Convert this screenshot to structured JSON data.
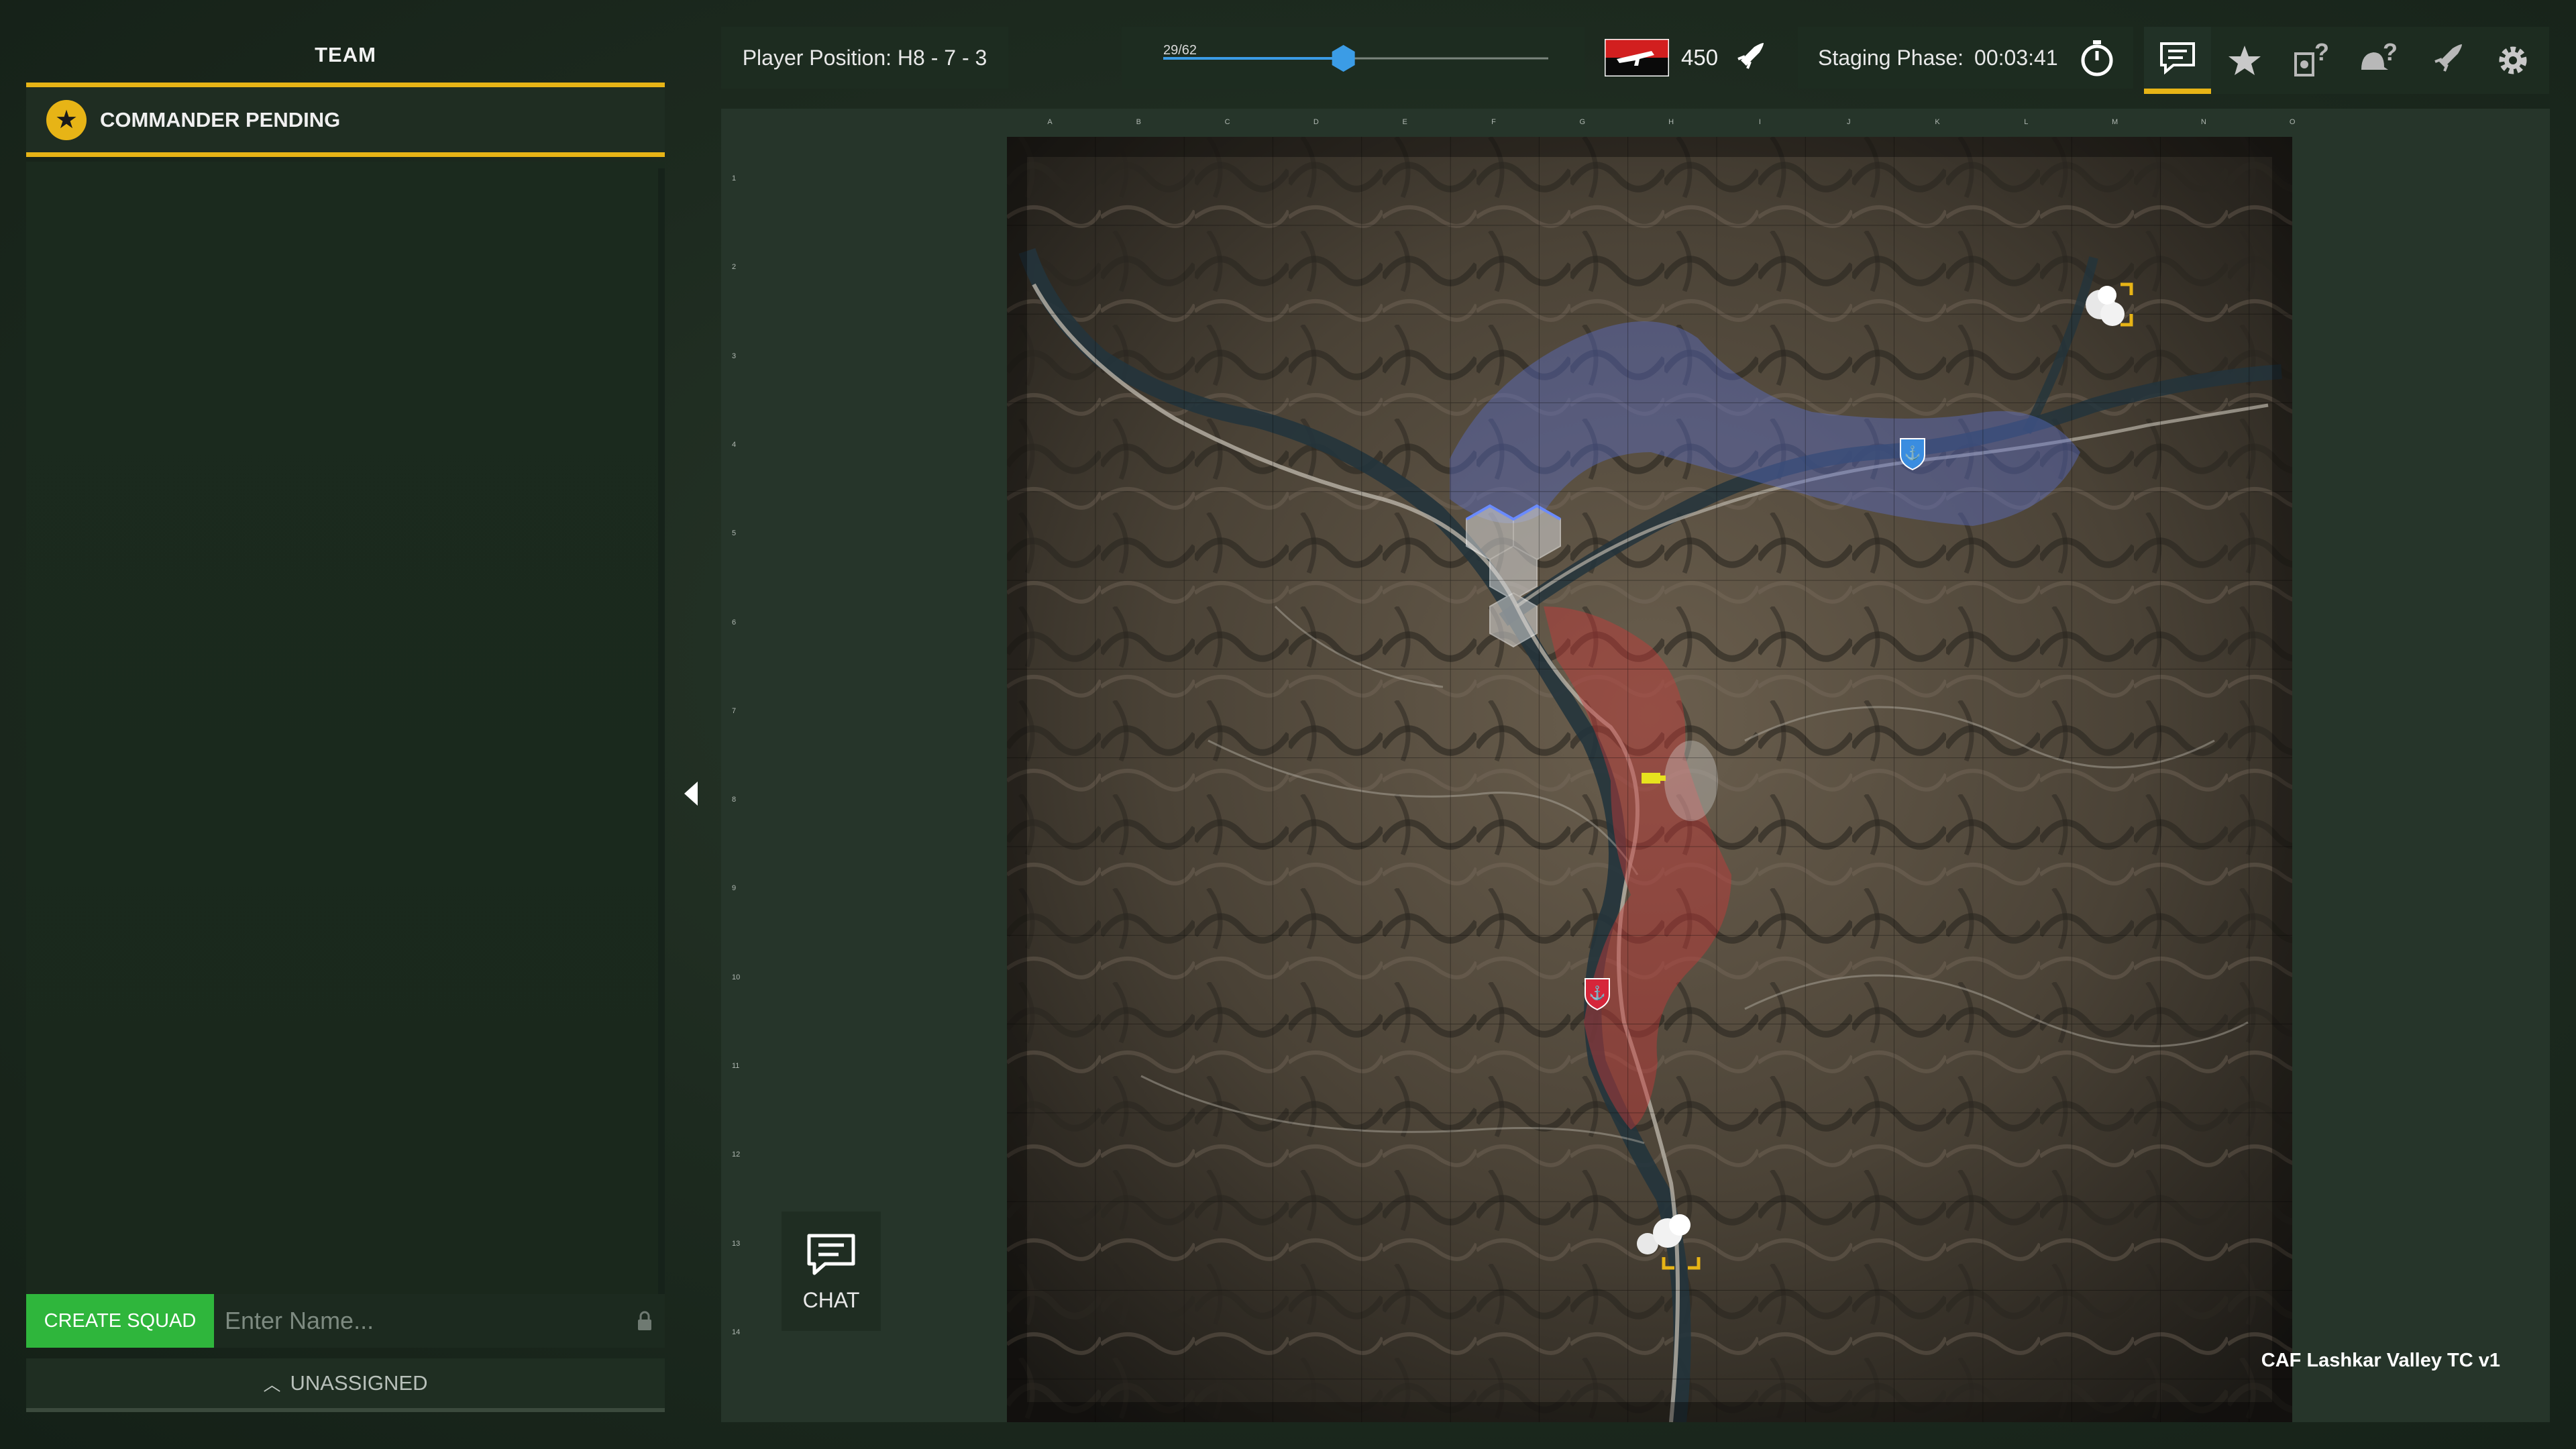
{
  "team_panel": {
    "title": "TEAM",
    "commander_label": "COMMANDER PENDING",
    "create_squad_label": "CREATE SQUAD",
    "squad_name_placeholder": "Enter Name...",
    "unassigned_label": "UNASSIGNED"
  },
  "top_bar": {
    "player_position": "Player Position: H8 - 7 - 3",
    "player_count_label": "29/62",
    "player_count_fraction": 0.468,
    "tickets": "450",
    "staging_label": "Staging Phase:",
    "staging_timer": "00:03:41"
  },
  "toolbar": {
    "items": [
      {
        "icon": "chat-bubble-icon",
        "active": true
      },
      {
        "icon": "star-icon",
        "active": false
      },
      {
        "icon": "vehicle-help-icon",
        "active": false
      },
      {
        "icon": "helmet-help-icon",
        "active": false
      },
      {
        "icon": "rocket-icon",
        "active": false
      },
      {
        "icon": "gear-icon",
        "active": false
      }
    ]
  },
  "map": {
    "title": "CAF Lashkar Valley TC v1",
    "columns": [
      "A",
      "B",
      "C",
      "D",
      "E",
      "F",
      "G",
      "H",
      "I",
      "J",
      "K",
      "L",
      "M",
      "N",
      "O"
    ],
    "rows": [
      "1",
      "2",
      "3",
      "4",
      "5",
      "6",
      "7",
      "8",
      "9",
      "10",
      "11",
      "12",
      "13",
      "14"
    ]
  },
  "chat_button": {
    "label": "CHAT"
  },
  "colors": {
    "accent": "#e7b416",
    "create_squad": "#2fb63c",
    "progress": "#3b9ce6",
    "blue_team": "#5a6fd0",
    "red_team": "#c83a3a"
  }
}
